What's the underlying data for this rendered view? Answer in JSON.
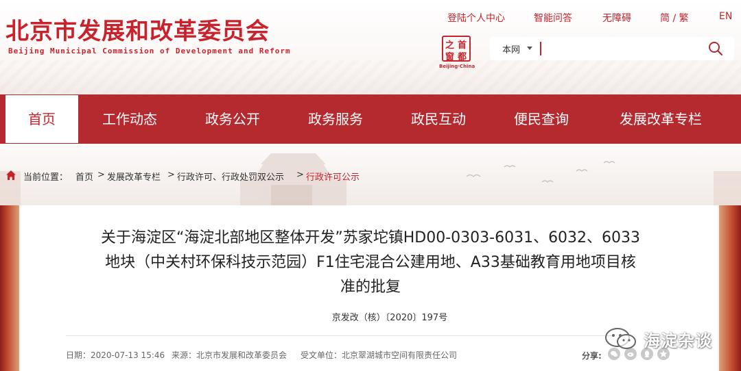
{
  "header": {
    "logo_cn": "北京市发展和改革委员会",
    "logo_en": "Beijing Municipal Commission of Development and Reform",
    "top_links": [
      "登陆个人中心",
      "智能问答",
      "无障碍",
      "简 / 繁",
      "EN"
    ],
    "seal_chars": [
      "首",
      "都",
      "之",
      "窗"
    ],
    "seal_caption": "Beijing·China",
    "search": {
      "scope": "本网",
      "value": "",
      "placeholder": ""
    }
  },
  "nav": {
    "items": [
      "首页",
      "工作动态",
      "政务公开",
      "政务服务",
      "政民互动",
      "便民查询",
      "发展改革专栏"
    ],
    "active_index": 0
  },
  "breadcrumb": {
    "label": "当前位置：",
    "items": [
      "首页",
      "发展改革专栏",
      "行政许可、行政处罚双公示",
      "行政许可公示"
    ],
    "separator": ">"
  },
  "article": {
    "title_lines": [
      "关于海淀区“海淀北部地区整体开发”苏家坨镇HD00-0303-6031、6032、6033",
      "地块（中关村环保科技示范园）F1住宅混合公建用地、A33基础教育用地项目核",
      "准的批复"
    ],
    "doc_number": "京发改（核）〔2020〕197号",
    "date": "日期：2020-07-13 15:46",
    "source": "来源：北京市发展和改革委员会",
    "recipient": "受文单位：北京翠湖城市空间有限责任公司",
    "share_label": "分享:"
  },
  "watermark": {
    "text": "海淀杂谈"
  },
  "colors": {
    "brand_red": "#c8232c",
    "nav_bg": "#b52a2f"
  },
  "icons": [
    "search-icon",
    "home-icon",
    "wechat-icon",
    "weibo-icon",
    "qq-icon",
    "qzone-icon"
  ]
}
